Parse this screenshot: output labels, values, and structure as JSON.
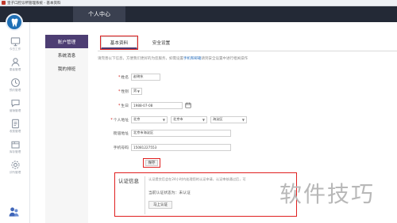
{
  "window": {
    "title": "皇子口腔诊所管理系统 - 基本资料"
  },
  "topbar": {
    "active_tab": "个人中心"
  },
  "sidebar": {
    "items": [
      {
        "label": "今日工作",
        "icon": "monitor-icon"
      },
      {
        "label": "患者管理",
        "icon": "person-icon"
      },
      {
        "label": "预约管理",
        "icon": "clock-icon"
      },
      {
        "label": "营销管理",
        "icon": "chat-icon"
      },
      {
        "label": "收费管理",
        "icon": "doc-icon"
      },
      {
        "label": "库存管理",
        "icon": "box-icon"
      },
      {
        "label": "诊所管理",
        "icon": "gear-icon"
      }
    ]
  },
  "submenu": {
    "items": [
      {
        "label": "账户管理",
        "active": true
      },
      {
        "label": "系统消息",
        "active": false
      },
      {
        "label": "我的排班",
        "active": false
      }
    ]
  },
  "tabs": {
    "basic": "基本资料",
    "security": "安全设置"
  },
  "notice": {
    "text_before": "请完善以下信息，方便我们更好的为您服务，如需设置",
    "link": "手机和邮箱",
    "text_after": "请到安全设置中进行相关操作"
  },
  "form": {
    "name": {
      "label": "姓名",
      "value": "赵晓东"
    },
    "gender": {
      "label": "性别",
      "value": "男"
    },
    "birthday": {
      "label": "生日",
      "value": "1988-07-08"
    },
    "address": {
      "label": "个人地址",
      "province": "北京",
      "city": "北京市",
      "district": "海淀区"
    },
    "detail": {
      "label": "街道地址",
      "value": "北京市海淀区"
    },
    "phone": {
      "label": "手机号码",
      "value": "15081227553"
    },
    "save_label": "保存"
  },
  "certification": {
    "title": "认证信息",
    "description": "认证提交后会在24小时内处理您的认证申请，认证审核通过后，可",
    "status": "当前认证状态为：未认证",
    "button": "马上认证"
  },
  "watermark": "软件技巧",
  "colors": {
    "topbar": "#232936",
    "accent": "#4d3e73",
    "highlight": "#e02020",
    "logo": "#1f6fb5"
  }
}
